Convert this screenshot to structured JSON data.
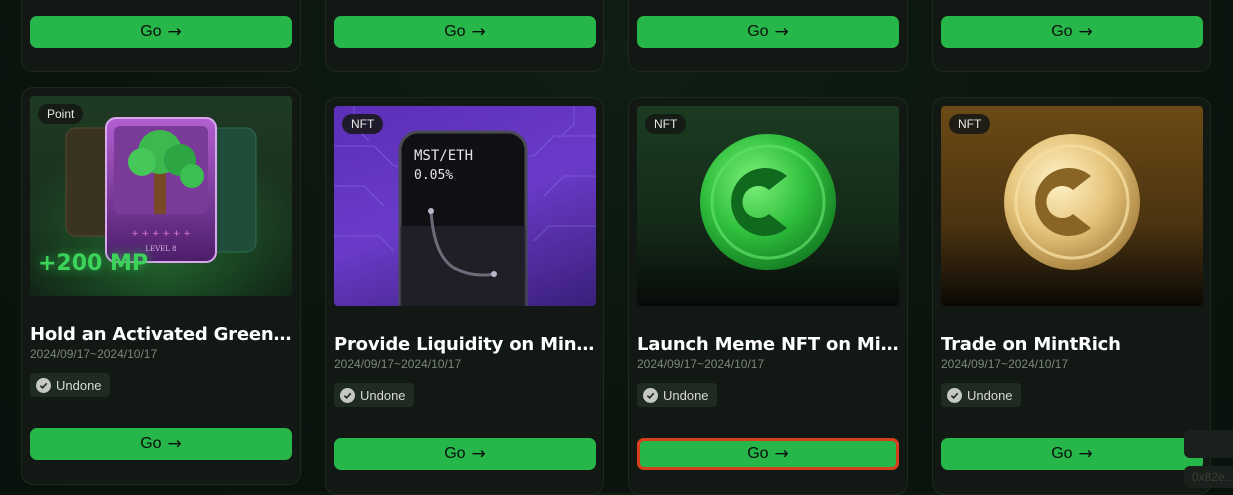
{
  "go_label": "Go",
  "top_row": [
    {
      "button": "Go"
    },
    {
      "button": "Go"
    },
    {
      "button": "Go"
    },
    {
      "button": "Go"
    }
  ],
  "cards": [
    {
      "tag": "Point",
      "title": "Hold an Activated GreenID…",
      "date": "2024/09/17~2024/10/17",
      "status": "Undone",
      "button": "Go",
      "bonus": "+200 MP",
      "level_text": "LEVEL 8"
    },
    {
      "tag": "NFT",
      "title": "Provide Liquidity on MintS…",
      "date": "2024/09/17~2024/10/17",
      "status": "Undone",
      "button": "Go",
      "pair": "MST/ETH",
      "fee": "0.05%"
    },
    {
      "tag": "NFT",
      "title": "Launch Meme NFT on Min…",
      "date": "2024/09/17~2024/10/17",
      "status": "Undone",
      "button": "Go"
    },
    {
      "tag": "NFT",
      "title": "Trade on MintRich",
      "date": "2024/09/17~2024/10/17",
      "status": "Undone",
      "button": "Go"
    }
  ],
  "ghost_text": "0x82e..."
}
